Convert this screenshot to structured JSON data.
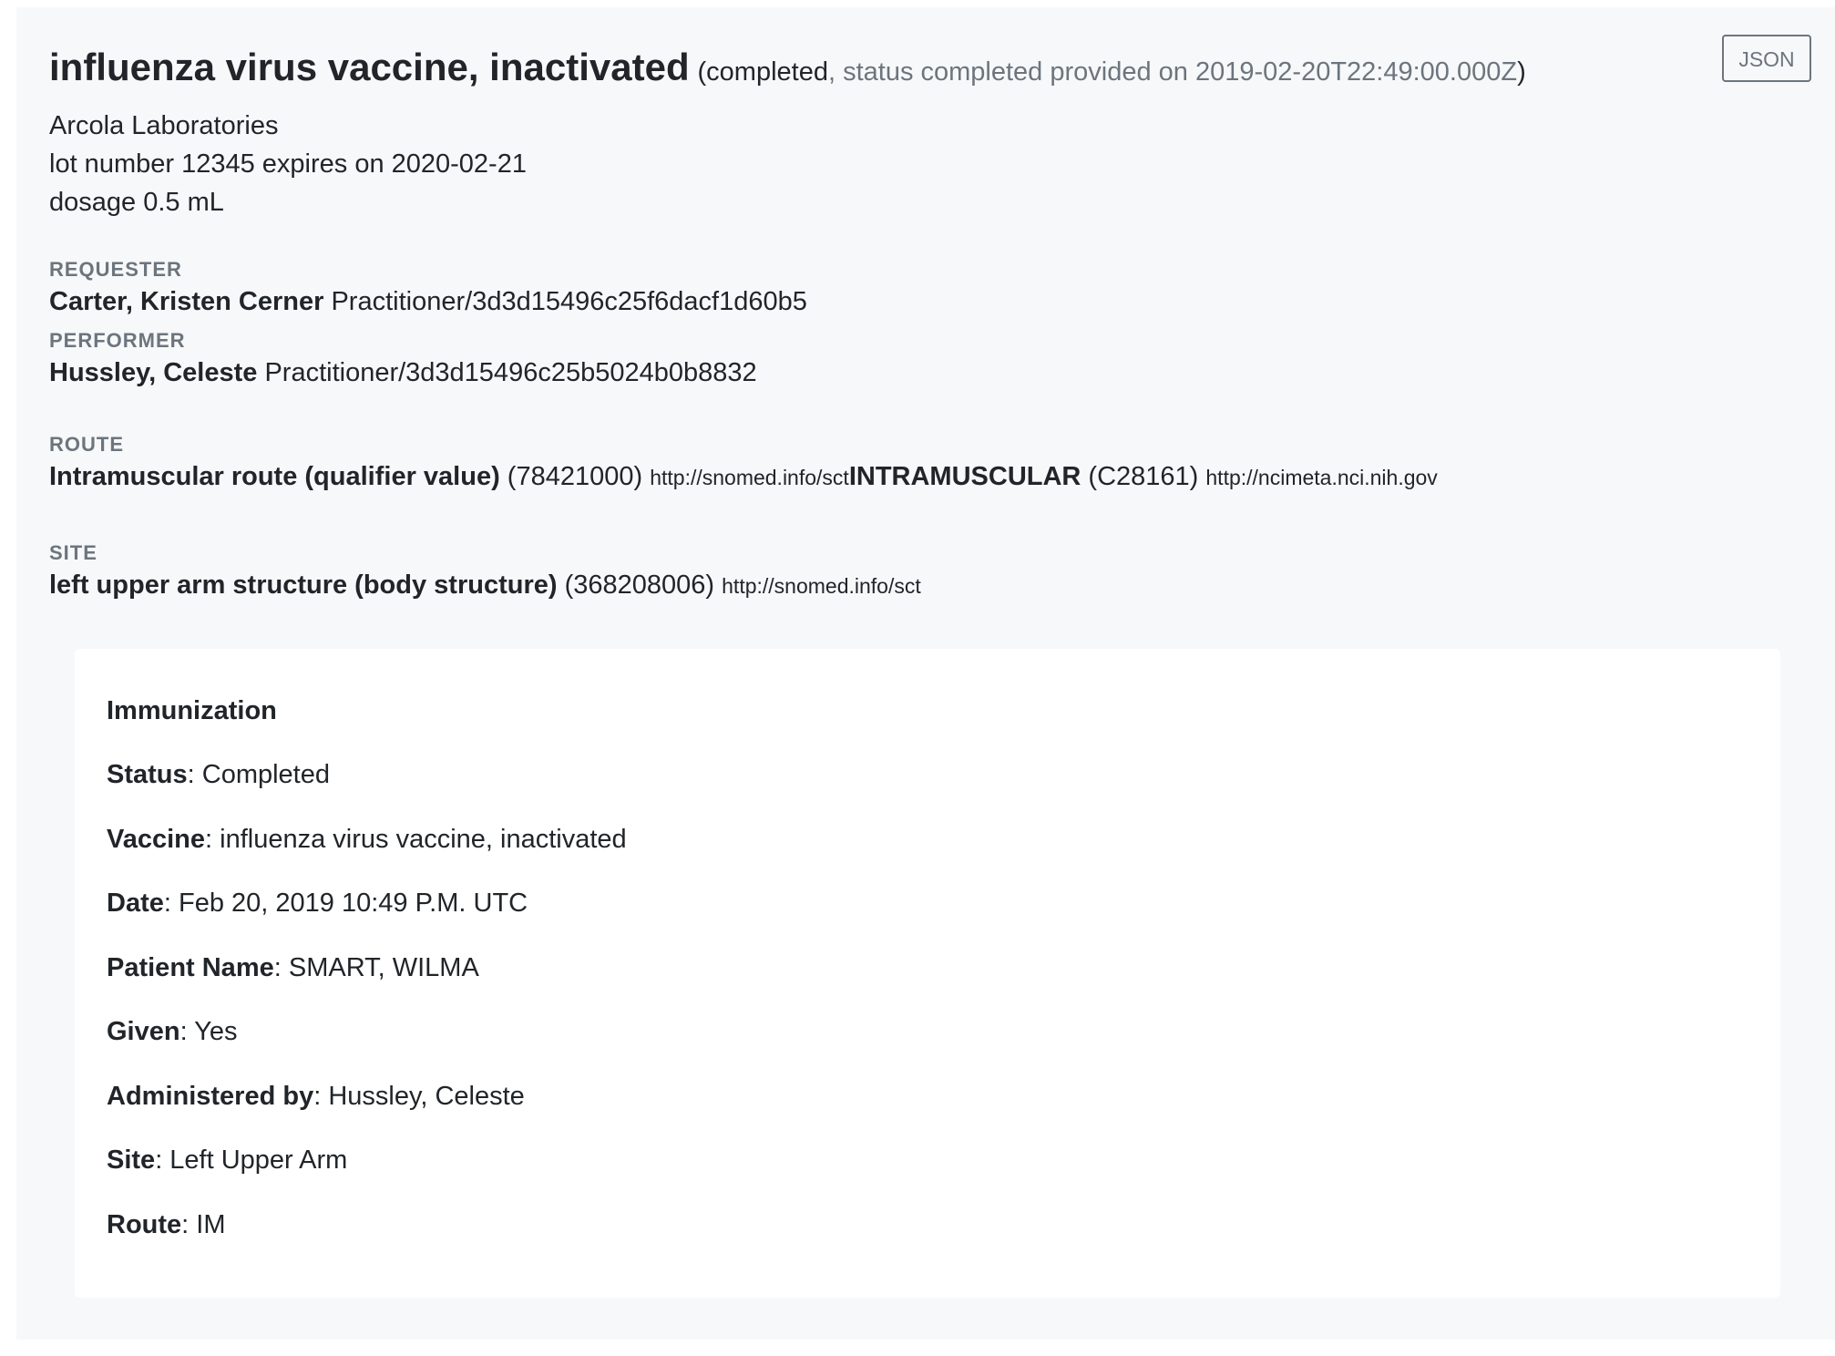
{
  "header": {
    "title": "influenza virus vaccine, inactivated",
    "status_open": "(completed",
    "status_detail": ", status completed provided on 2019-02-20T22:49:00.000Z",
    "status_close": ")",
    "json_button": "JSON"
  },
  "meta": {
    "manufacturer": "Arcola Laboratories",
    "lot": "lot number 12345 expires on 2020-02-21",
    "dosage": "dosage 0.5 mL"
  },
  "requester": {
    "label": "REQUESTER",
    "name": "Carter, Kristen Cerner",
    "reference": "Practitioner/3d3d15496c25f6dacf1d60b5"
  },
  "performer": {
    "label": "PERFORMER",
    "name": "Hussley, Celeste",
    "reference": "Practitioner/3d3d15496c25b5024b0b8832"
  },
  "route": {
    "label": "ROUTE",
    "codings": [
      {
        "display": "Intramuscular route (qualifier value)",
        "code": "(78421000)",
        "system": "http://snomed.info/sct"
      },
      {
        "display": "INTRAMUSCULAR",
        "code": "(C28161)",
        "system": "http://ncimeta.nci.nih.gov"
      }
    ]
  },
  "site": {
    "label": "SITE",
    "display": "left upper arm structure (body structure)",
    "code": "(368208006)",
    "system": "http://snomed.info/sct"
  },
  "narrative": {
    "heading": "Immunization",
    "rows": [
      {
        "key": "Status",
        "value": ": Completed"
      },
      {
        "key": "Vaccine",
        "value": ": influenza virus vaccine, inactivated"
      },
      {
        "key": "Date",
        "value": ": Feb 20, 2019 10:49 P.M. UTC"
      },
      {
        "key": "Patient Name",
        "value": ": SMART, WILMA"
      },
      {
        "key": "Given",
        "value": ": Yes"
      },
      {
        "key": "Administered by",
        "value": ": Hussley, Celeste"
      },
      {
        "key": "Site",
        "value": ": Left Upper Arm"
      },
      {
        "key": "Route",
        "value": ": IM"
      }
    ]
  }
}
